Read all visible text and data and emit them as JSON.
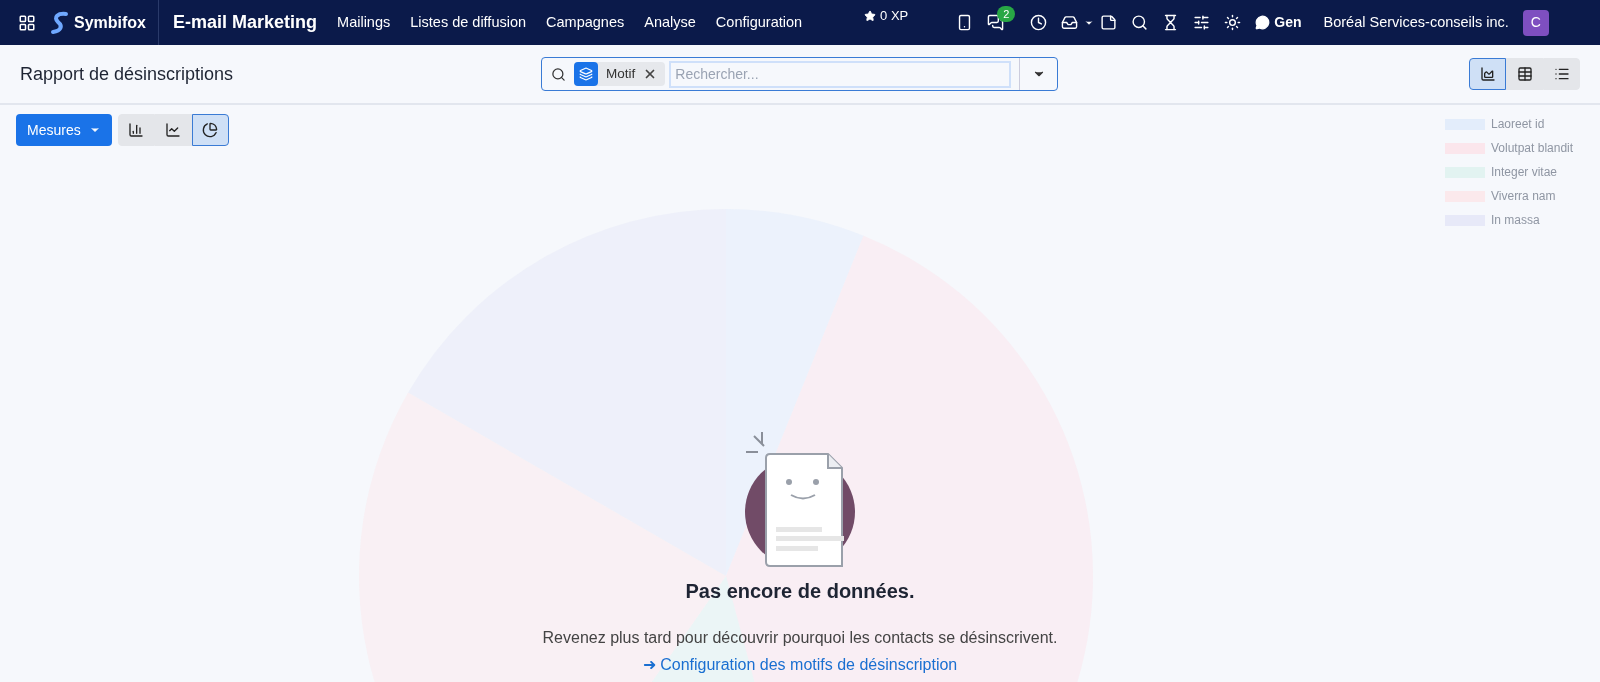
{
  "navbar": {
    "brand": "Symbifox",
    "app_title": "E-mail Marketing",
    "menu": [
      "Mailings",
      "Listes de diffusion",
      "Campagnes",
      "Analyse",
      "Configuration"
    ],
    "xp": "0 XP",
    "messages_badge": "2",
    "chat_label": "Gen",
    "company": "Boréal Services-conseils inc.",
    "avatar_letter": "C"
  },
  "control_panel": {
    "title": "Rapport de désinscriptions",
    "search": {
      "facet": "Motif",
      "placeholder": "Rechercher..."
    },
    "views": [
      {
        "kind": "graph",
        "selected": true
      },
      {
        "kind": "pivot",
        "selected": false
      },
      {
        "kind": "list",
        "selected": false
      }
    ]
  },
  "toolbar": {
    "measures": "Mesures",
    "chart_types": [
      {
        "kind": "bar",
        "selected": false
      },
      {
        "kind": "line",
        "selected": false
      },
      {
        "kind": "pie",
        "selected": true
      }
    ]
  },
  "sample_legend": [
    {
      "label": "Laoreet id",
      "color": "#e3edfb"
    },
    {
      "label": "Volutpat blandit",
      "color": "#fbe6ec"
    },
    {
      "label": "Integer vitae",
      "color": "#e2f3f1"
    },
    {
      "label": "Viverra nam",
      "color": "#fbe9ec"
    },
    {
      "label": "In massa",
      "color": "#e7e9f8"
    }
  ],
  "empty_state": {
    "title": "Pas encore de données.",
    "message": "Revenez plus tard pour découvrir pourquoi les contacts se désinscrivent.",
    "link": "➜ Configuration des motifs de désinscription"
  }
}
